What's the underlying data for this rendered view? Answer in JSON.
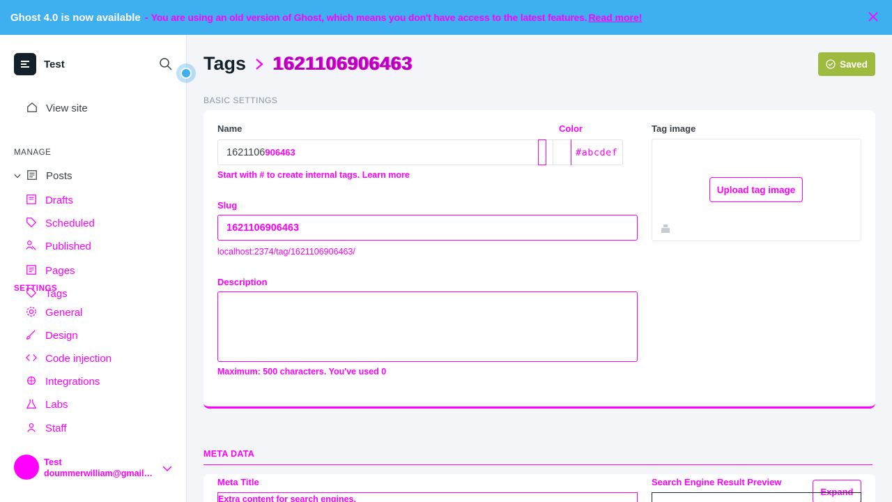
{
  "banner": {
    "title": "Ghost 4.0 is now available",
    "dash": "-",
    "message": "You are using an old version of Ghost, which means you don't have access to the latest features.",
    "link": "Read more!"
  },
  "brand": {
    "name": "Test"
  },
  "sidebar": {
    "view_site": "View site",
    "manage_label": "MANAGE",
    "posts": "Posts",
    "settings_label": "SETTINGS",
    "items": [
      {
        "label": "Drafts"
      },
      {
        "label": "Scheduled"
      },
      {
        "label": "Published"
      },
      {
        "label": "Pages"
      },
      {
        "label": "Tags"
      },
      {
        "label": "General"
      },
      {
        "label": "Design"
      },
      {
        "label": "Code injection"
      },
      {
        "label": "Integrations"
      },
      {
        "label": "Labs"
      },
      {
        "label": "Staff"
      }
    ]
  },
  "user": {
    "name": "Test",
    "email": "doummerwilliam@gmail.com"
  },
  "main": {
    "breadcrumb_parent": "Tags",
    "breadcrumb_current": "1621106906463",
    "saved_label": "Saved",
    "basic_settings": "BASIC SETTINGS",
    "name_label": "Name",
    "name_value_a": "1621106",
    "name_value_b": "906463",
    "name_hint": "Start with # to create internal tags. Learn more",
    "color_label": "Color",
    "color_value": "#abcdef",
    "tag_image_label": "Tag image",
    "upload_label": "Upload tag image",
    "slug_label": "Slug",
    "slug_value": "1621106906463",
    "slug_url": "localhost:2374/tag/1621106906463/",
    "description_label": "Description",
    "description_hint": "Maximum: 500 characters. You've used 0",
    "meta_head": "META DATA",
    "meta_title_label": "Meta Title",
    "meta_input_text": "Extra content for search engines.",
    "search_preview_label": "Search Engine Result Preview",
    "expand_label": "Expand"
  },
  "colors": {
    "banner": "#3eb0ef",
    "saved": "#9fbb3f",
    "accent": "#ff00ff"
  }
}
